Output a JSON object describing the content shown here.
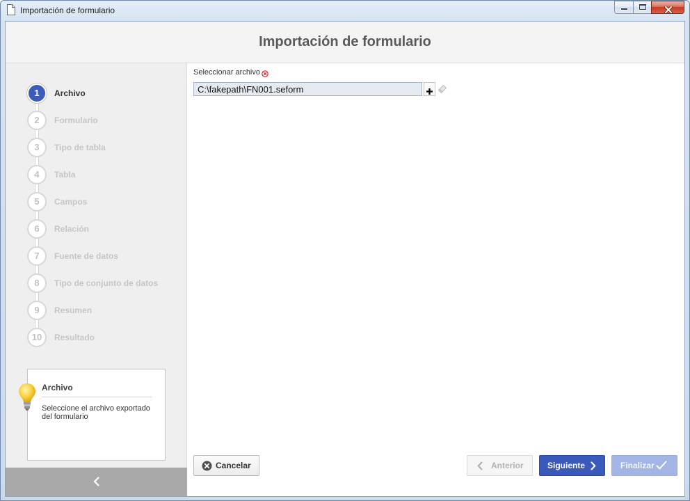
{
  "window": {
    "title": "Importación de formulario",
    "icon": "document-icon",
    "controls": [
      "minimize-icon",
      "maximize-icon",
      "close-icon"
    ]
  },
  "header": {
    "title": "Importación de formulario"
  },
  "wizard": {
    "steps": [
      {
        "number": "1",
        "label": "Archivo",
        "active": true
      },
      {
        "number": "2",
        "label": "Formulario",
        "active": false
      },
      {
        "number": "3",
        "label": "Tipo de tabla",
        "active": false
      },
      {
        "number": "4",
        "label": "Tabla",
        "active": false
      },
      {
        "number": "5",
        "label": "Campos",
        "active": false
      },
      {
        "number": "6",
        "label": "Relación",
        "active": false
      },
      {
        "number": "7",
        "label": "Fuente de datos",
        "active": false
      },
      {
        "number": "8",
        "label": "Tipo de conjunto de datos",
        "active": false
      },
      {
        "number": "9",
        "label": "Resumen",
        "active": false
      },
      {
        "number": "10",
        "label": "Resultado",
        "active": false
      }
    ]
  },
  "help": {
    "icon": "lightbulb-icon",
    "title": "Archivo",
    "description": "Seleccione el archivo exportado del formulario"
  },
  "sidebar": {
    "collapse_icon": "chevron-left-icon"
  },
  "form": {
    "file_label": "Seleccionar archivo",
    "file_required": true,
    "required_icon": "required-icon",
    "file_value": "C:\\fakepath\\FN001.seform",
    "add_icon": "plus-icon",
    "clear_icon": "eraser-icon",
    "clear_enabled": false
  },
  "buttons": {
    "cancel": {
      "label": "Cancelar",
      "icon": "cancel-circle-icon",
      "enabled": true
    },
    "previous": {
      "label": "Anterior",
      "icon": "chevron-left-icon",
      "enabled": false
    },
    "next": {
      "label": "Siguiente",
      "icon": "chevron-right-icon",
      "enabled": true
    },
    "finish": {
      "label": "Finalizar",
      "icon": "check-icon",
      "enabled": false
    }
  },
  "colors": {
    "accent": "#3a5abb",
    "accent_disabled": "#a2b5e5",
    "step_active": "#3d5cb8",
    "required": "#d8232a",
    "close_button": "#c53a22"
  }
}
